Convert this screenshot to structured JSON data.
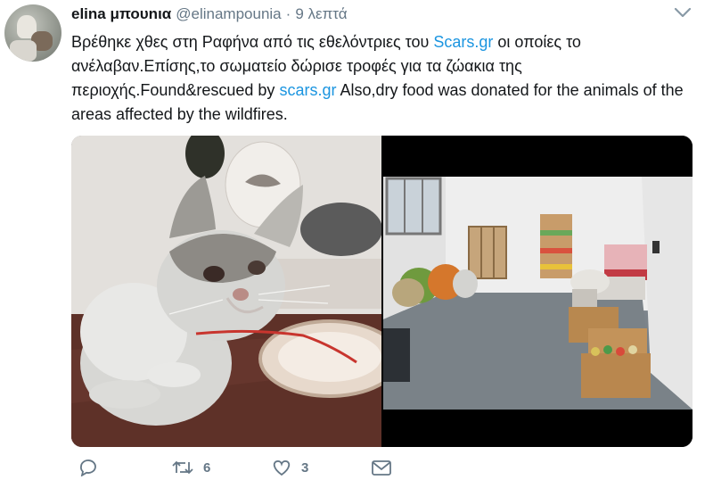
{
  "user": {
    "display_name": "elina μπουnια",
    "handle": "@elinampounia",
    "separator": "·",
    "time": "9 λεπτά"
  },
  "tweet": {
    "text_part1": "Βρέθηκε χθες στη Ραφήνα από τις εθελόντριες του ",
    "link1": "Scars.gr",
    "text_part2": " οι οποίες το ανέλαβαν.Επίσης,το σωματείο δώρισε τροφές για τα ζώακια της περιοχής.Found&rescued by ",
    "link2": "scars.gr",
    "text_part3": " Also,dry food was donated for the animals of the areas affected by the wildfires."
  },
  "actions": {
    "reply_count": "",
    "retweet_count": "6",
    "like_count": "3"
  },
  "colors": {
    "link": "#1b95e0",
    "secondary_text": "#657786",
    "primary_text": "#14171a"
  }
}
